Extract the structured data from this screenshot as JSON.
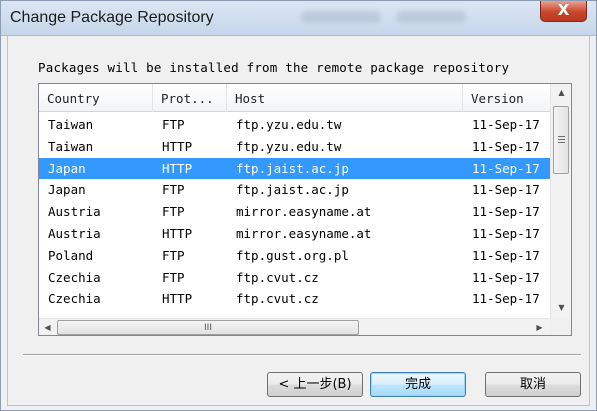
{
  "window": {
    "title": "Change Package Repository",
    "close_glyph": "X"
  },
  "info_text": "Packages will be installed from the remote package repository",
  "table": {
    "columns": [
      "Country",
      "Prot...",
      "Host",
      "Version"
    ],
    "rows": [
      {
        "country": "Taiwan",
        "protocol": "FTP",
        "host": "ftp.yzu.edu.tw",
        "version": "11-Sep-17"
      },
      {
        "country": "Taiwan",
        "protocol": "HTTP",
        "host": "ftp.yzu.edu.tw",
        "version": "11-Sep-17"
      },
      {
        "country": "Japan",
        "protocol": "HTTP",
        "host": "ftp.jaist.ac.jp",
        "version": "11-Sep-17"
      },
      {
        "country": "Japan",
        "protocol": "FTP",
        "host": "ftp.jaist.ac.jp",
        "version": "11-Sep-17"
      },
      {
        "country": "Austria",
        "protocol": "FTP",
        "host": "mirror.easyname.at",
        "version": "11-Sep-17"
      },
      {
        "country": "Austria",
        "protocol": "HTTP",
        "host": "mirror.easyname.at",
        "version": "11-Sep-17"
      },
      {
        "country": "Poland",
        "protocol": "FTP",
        "host": "ftp.gust.org.pl",
        "version": "11-Sep-17"
      },
      {
        "country": "Czechia",
        "protocol": "FTP",
        "host": "ftp.cvut.cz",
        "version": "11-Sep-17"
      },
      {
        "country": "Czechia",
        "protocol": "HTTP",
        "host": "ftp.cvut.cz",
        "version": "11-Sep-17"
      }
    ],
    "selected_row_index": 2
  },
  "scrollbar": {
    "hthumb_glyph": "III",
    "up_icon": "▲",
    "down_icon": "▼",
    "left_icon": "◀",
    "right_icon": "▶"
  },
  "buttons": {
    "back": "< 上一步(B)",
    "finish": "完成",
    "cancel": "取消"
  },
  "colors": {
    "selection": "#3399ff",
    "close_button": "#c9452b"
  }
}
